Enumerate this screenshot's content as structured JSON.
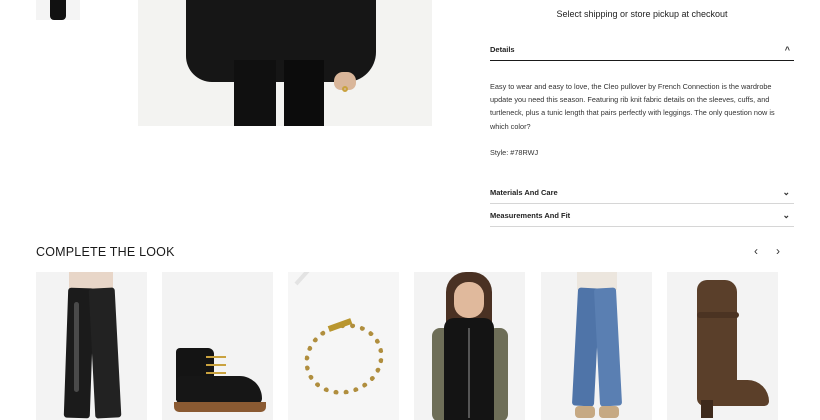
{
  "shipping_note": "Select shipping or store pickup at checkout",
  "details": {
    "heading": "Details",
    "description": "Easy to wear and easy to love, the Cleo pullover by French Connection is the wardrobe update you need this season. Featuring rib knit fabric details on the sleeves, cuffs, and turtleneck, plus a tunic length that pairs perfectly with leggings. The only question now is which color?",
    "style": "Style: #78RWJ"
  },
  "materials": {
    "heading": "Materials And Care"
  },
  "measurements": {
    "heading": "Measurements And Fit"
  },
  "complete_the_look": {
    "title": "COMPLETE THE LOOK",
    "prev_arrow": "‹",
    "next_arrow": "›"
  },
  "icons": {
    "chevron_up": "^",
    "chevron_down": "⌄"
  }
}
